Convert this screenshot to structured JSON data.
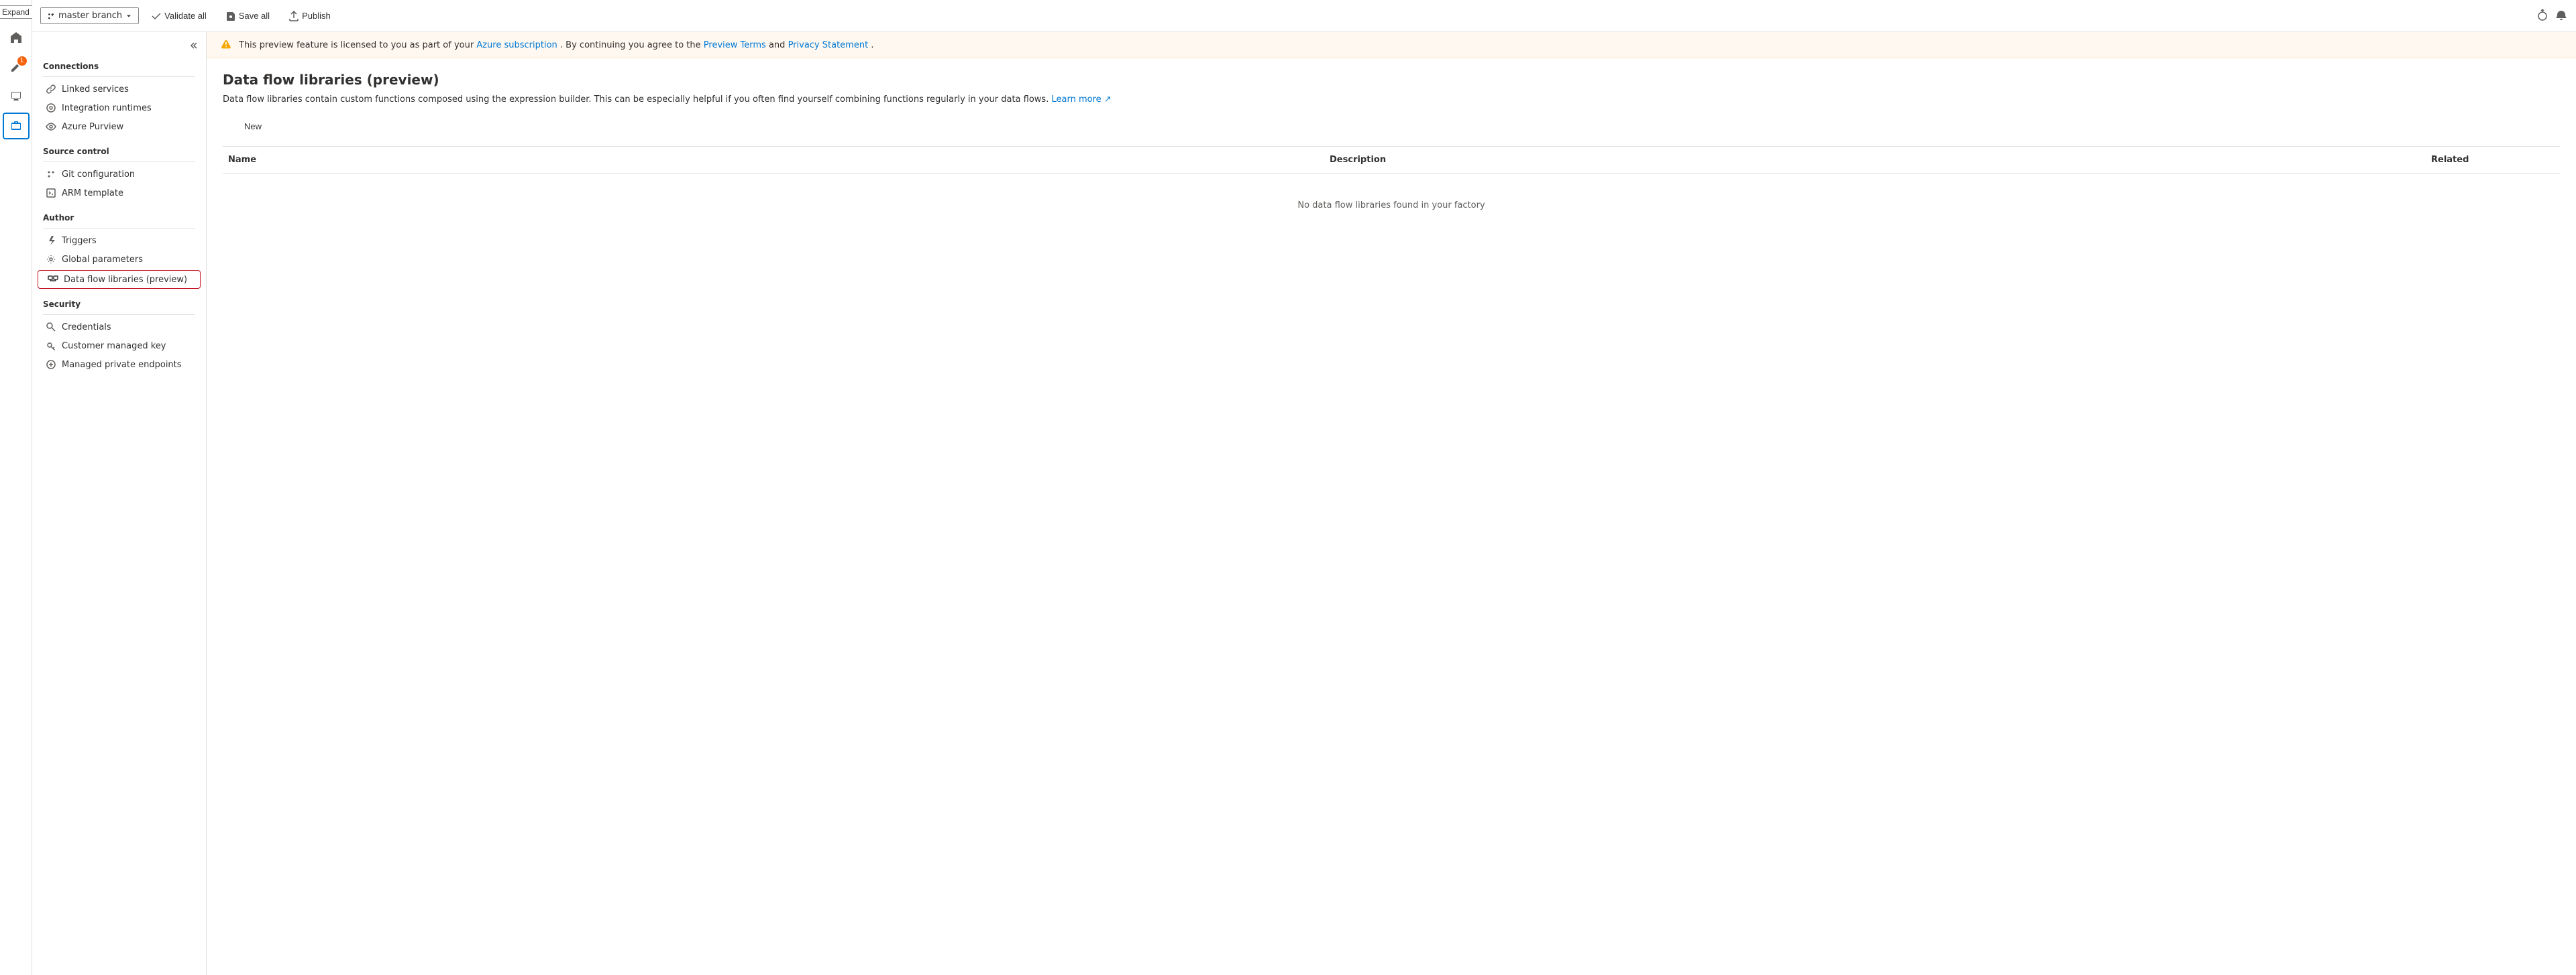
{
  "iconBar": {
    "expandLabel": "Expand",
    "items": [
      {
        "name": "home",
        "icon": "home",
        "active": false
      },
      {
        "name": "author",
        "icon": "pencil",
        "badge": "1",
        "active": false
      },
      {
        "name": "monitor",
        "icon": "monitor",
        "active": false
      },
      {
        "name": "manage",
        "icon": "briefcase",
        "active": true
      }
    ]
  },
  "topBar": {
    "branchLabel": "master branch",
    "validateAllLabel": "Validate all",
    "saveAllLabel": "Save all",
    "publishLabel": "Publish"
  },
  "alert": {
    "text": "This preview feature is licensed to you as part of your",
    "azureSubscriptionLabel": "Azure subscription",
    "midText": ". By continuing you agree to the",
    "previewTermsLabel": "Preview Terms",
    "andText": "and",
    "privacyStatementLabel": "Privacy Statement",
    "endText": "."
  },
  "sidebar": {
    "connections": {
      "title": "Connections",
      "items": [
        {
          "label": "Linked services",
          "icon": "link"
        },
        {
          "label": "Integration runtimes",
          "icon": "runtime"
        },
        {
          "label": "Azure Purview",
          "icon": "eye"
        }
      ]
    },
    "sourceControl": {
      "title": "Source control",
      "items": [
        {
          "label": "Git configuration",
          "icon": "git"
        },
        {
          "label": "ARM template",
          "icon": "arm"
        }
      ]
    },
    "author": {
      "title": "Author",
      "items": [
        {
          "label": "Triggers",
          "icon": "lightning"
        },
        {
          "label": "Global parameters",
          "icon": "settings"
        },
        {
          "label": "Data flow libraries (preview)",
          "icon": "dataflow",
          "active": true
        }
      ]
    },
    "security": {
      "title": "Security",
      "items": [
        {
          "label": "Credentials",
          "icon": "credentials"
        },
        {
          "label": "Customer managed key",
          "icon": "key"
        },
        {
          "label": "Managed private endpoints",
          "icon": "privateendpoint"
        }
      ]
    }
  },
  "mainContent": {
    "title": "Data flow libraries (preview)",
    "description": "Data flow libraries contain custom functions composed using the expression builder. This can be especially helpful if you often find yourself combining functions regularly in your data flows.",
    "learnMoreLabel": "Learn more",
    "newButtonLabel": "New",
    "table": {
      "headers": [
        "Name",
        "Description",
        "Related"
      ],
      "emptyMessage": "No data flow libraries found in your factory"
    }
  }
}
